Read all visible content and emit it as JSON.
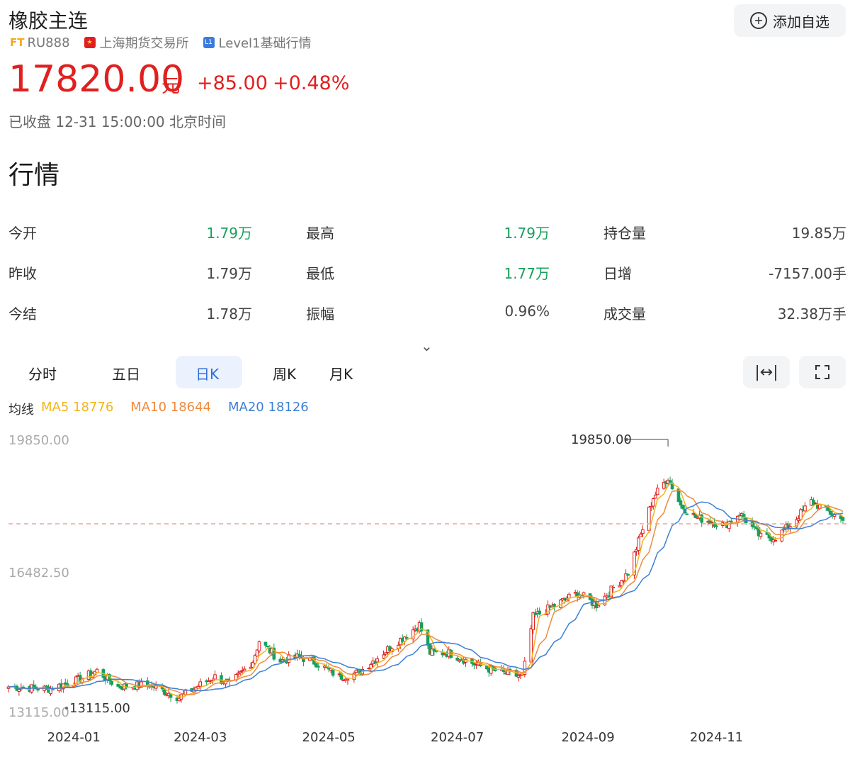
{
  "header": {
    "title": "橡胶主连",
    "add_label": "添加自选",
    "ft_tag": "FT",
    "code": "RU888",
    "exchange": "上海期货交易所",
    "level_badge": "L1",
    "level": "Level1基础行情"
  },
  "quote": {
    "price": "17820.00",
    "unit": "元",
    "change": "+85.00",
    "change_pct": "+0.48%",
    "status": "已收盘 12-31 15:00:00 北京时间",
    "up_color": "#e02020"
  },
  "section_title": "行情",
  "stats": [
    {
      "label": "今开",
      "value": "1.79万",
      "color": "green"
    },
    {
      "label": "最高",
      "value": "1.79万",
      "color": "green"
    },
    {
      "label": "持仓量",
      "value": "19.85万",
      "color": "gray"
    },
    {
      "label": "昨收",
      "value": "1.79万",
      "color": "gray"
    },
    {
      "label": "最低",
      "value": "1.77万",
      "color": "green"
    },
    {
      "label": "日增",
      "value": "-7157.00手",
      "color": "gray"
    },
    {
      "label": "今结",
      "value": "1.78万",
      "color": "gray"
    },
    {
      "label": "振幅",
      "value": "0.96%",
      "color": "gray"
    },
    {
      "label": "成交量",
      "value": "32.38万手",
      "color": "gray"
    }
  ],
  "tabs": [
    "分时",
    "五日",
    "日K",
    "周K",
    "月K"
  ],
  "active_tab": "日K",
  "tools": [
    "fit-width-icon",
    "fullscreen-icon"
  ],
  "ma": {
    "label": "均线",
    "ma5": "MA5 18776",
    "ma10": "MA10 18644",
    "ma20": "MA20 18126",
    "ma5_color": "#f2b41c",
    "ma10_color": "#f08a3c",
    "ma20_color": "#3d7fd6"
  },
  "chart_data": {
    "type": "candlestick",
    "y_max_label": "19850.00",
    "y_mid_label": "16482.50",
    "y_min_label": "13115.00",
    "ylim": [
      13115,
      19850
    ],
    "high_marker": "19850.00",
    "low_marker": "13115.00",
    "reference_price": 17735,
    "x_labels": [
      "2024-01",
      "2024-03",
      "2024-05",
      "2024-07",
      "2024-09",
      "2024-11"
    ],
    "x_range": [
      "2023-12-01",
      "2024-12-31"
    ],
    "anchors": [
      [
        "2023-12-01",
        13650
      ],
      [
        "2023-12-20",
        13600
      ],
      [
        "2024-01-02",
        13800
      ],
      [
        "2024-01-12",
        14050
      ],
      [
        "2024-01-22",
        13650
      ],
      [
        "2024-02-06",
        13700
      ],
      [
        "2024-02-20",
        13380
      ],
      [
        "2024-03-01",
        13700
      ],
      [
        "2024-03-08",
        13900
      ],
      [
        "2024-03-15",
        13700
      ],
      [
        "2024-03-26",
        14300
      ],
      [
        "2024-03-29",
        14800
      ],
      [
        "2024-04-08",
        14300
      ],
      [
        "2024-04-17",
        14400
      ],
      [
        "2024-04-25",
        14250
      ],
      [
        "2024-05-06",
        13900
      ],
      [
        "2024-05-15",
        14000
      ],
      [
        "2024-05-22",
        14300
      ],
      [
        "2024-06-03",
        14800
      ],
      [
        "2024-06-13",
        15200
      ],
      [
        "2024-06-18",
        14500
      ],
      [
        "2024-06-27",
        14500
      ],
      [
        "2024-07-10",
        14200
      ],
      [
        "2024-07-22",
        14000
      ],
      [
        "2024-08-01",
        13900
      ],
      [
        "2024-08-06",
        15400
      ],
      [
        "2024-08-20",
        15800
      ],
      [
        "2024-08-27",
        16000
      ],
      [
        "2024-09-05",
        15700
      ],
      [
        "2024-09-20",
        16500
      ],
      [
        "2024-10-02",
        18400
      ],
      [
        "2024-10-09",
        18900
      ],
      [
        "2024-10-15",
        18200
      ],
      [
        "2024-10-22",
        17900
      ],
      [
        "2024-11-05",
        17700
      ],
      [
        "2024-11-12",
        18000
      ],
      [
        "2024-11-22",
        17400
      ],
      [
        "2024-11-29",
        17400
      ],
      [
        "2024-12-06",
        17700
      ],
      [
        "2024-12-16",
        18300
      ],
      [
        "2024-12-31",
        17820
      ]
    ]
  }
}
